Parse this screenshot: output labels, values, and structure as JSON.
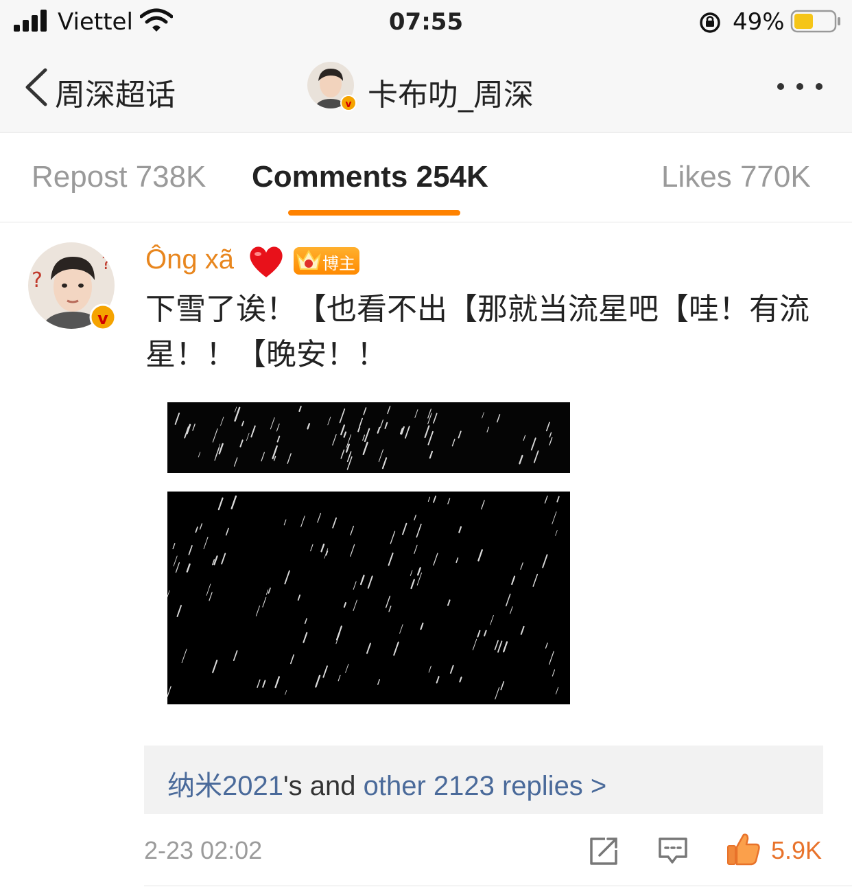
{
  "status_bar": {
    "carrier": "Viettel",
    "time": "07:55",
    "battery_percent": "49%",
    "battery_level": 0.49,
    "icons": [
      "signal-icon",
      "wifi-icon",
      "orientation-lock-icon",
      "battery-icon"
    ]
  },
  "nav": {
    "back_label": "周深超话",
    "title": "卡布叻_周深",
    "more_icon": "more-dots-icon"
  },
  "tabs": [
    {
      "label": "Repost 738K",
      "active": false
    },
    {
      "label": "Comments 254K",
      "active": true
    },
    {
      "label": "Likes 770K",
      "active": false
    }
  ],
  "comment": {
    "username": "Ông xã",
    "badge_label": "博主",
    "text": "下雪了诶！【也看不出【那就当流星吧【哇！有流星！！【晚安！！",
    "replies_link": {
      "name": "纳米2021",
      "middle": "'s and ",
      "other": "other 2123 replies >"
    },
    "timestamp": "2-23 02:02",
    "like_count": "5.9K"
  },
  "colors": {
    "accent_orange": "#ff8200",
    "username": "#e8861e",
    "link_blue": "#4a6a9a",
    "like_orange": "#e8722a"
  }
}
